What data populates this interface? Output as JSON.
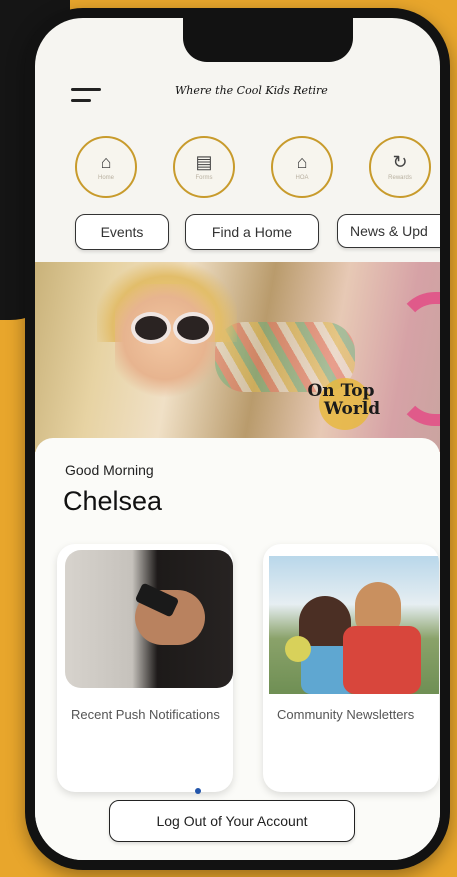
{
  "header": {
    "app_title": "Where the Cool Kids Retire",
    "menu_icon": "hamburger-menu-icon"
  },
  "quick_actions": [
    {
      "icon": "home-bell-icon",
      "caption": "Home"
    },
    {
      "icon": "document-icon",
      "caption": "Forms"
    },
    {
      "icon": "house-icon",
      "caption": "HOA"
    },
    {
      "icon": "refresh-home-icon",
      "caption": "Rewards"
    }
  ],
  "filter_pills": [
    "Events",
    "Find a Home",
    "News & Upd"
  ],
  "hero": {
    "logo_line1": "On Top",
    "logo_line2": "World"
  },
  "greeting": {
    "salutation": "Good Morning",
    "name": "Chelsea"
  },
  "cards": [
    {
      "label": "Recent Push Notifications"
    },
    {
      "label": "Community Newsletters"
    }
  ],
  "footer": {
    "logout_label": "Log Out of Your Account"
  },
  "colors": {
    "background": "#e8a62c",
    "accent_gold": "#c89b2c"
  }
}
